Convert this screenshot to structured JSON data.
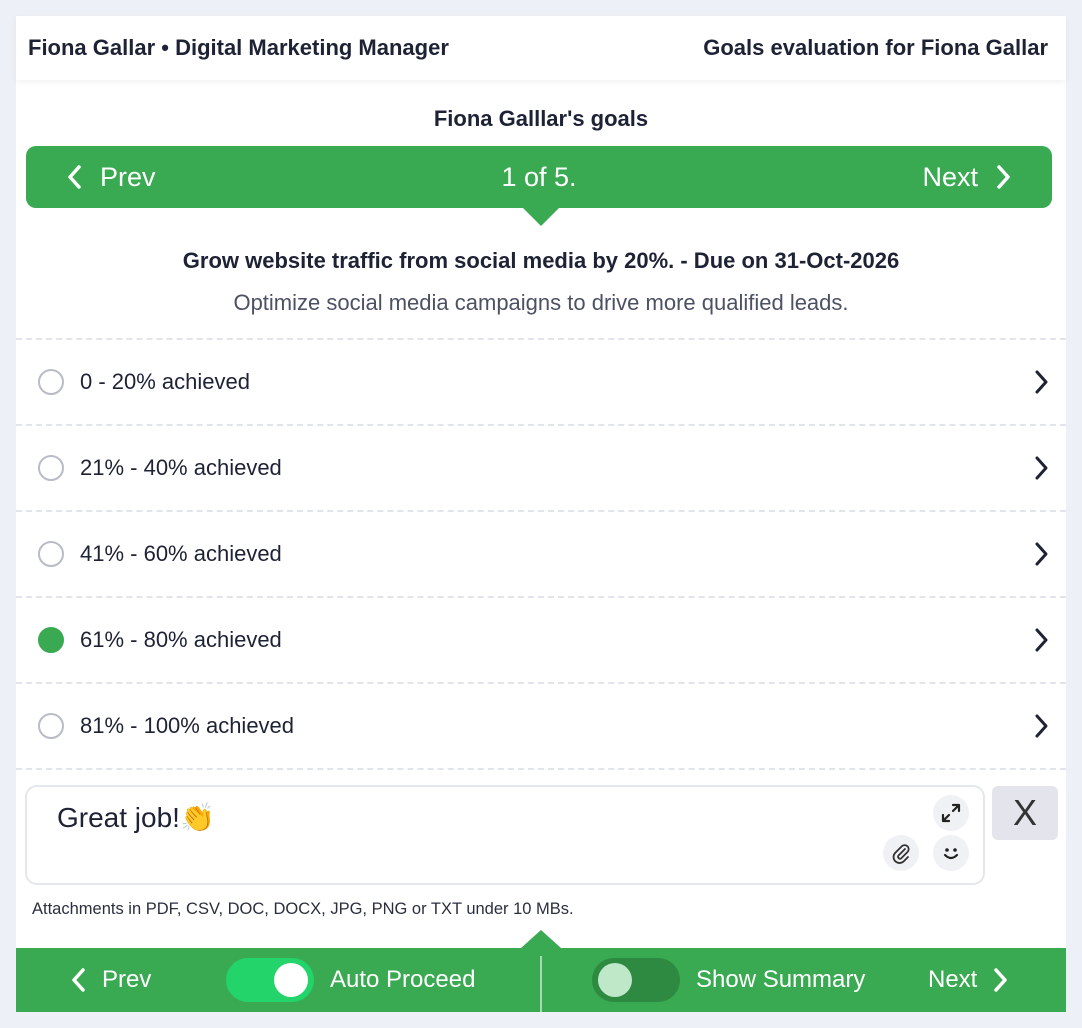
{
  "header": {
    "left": "Fiona Gallar • Digital Marketing Manager",
    "right": "Goals evaluation for Fiona Gallar"
  },
  "goals_title": "Fiona Galllar's goals",
  "goal_nav": {
    "prev": "Prev",
    "position": "1 of 5.",
    "next": "Next"
  },
  "goal": {
    "title": "Grow website traffic from social media by 20%. - Due on 31-Oct-2026",
    "description": "Optimize social media campaigns to drive more qualified leads."
  },
  "options": [
    {
      "label": "0 - 20% achieved",
      "selected": false
    },
    {
      "label": "21% - 40% achieved",
      "selected": false
    },
    {
      "label": "41% - 60% achieved",
      "selected": false
    },
    {
      "label": "61% - 80% achieved",
      "selected": true
    },
    {
      "label": "81% - 100% achieved",
      "selected": false
    }
  ],
  "comment": {
    "text": "Great job!👏",
    "clear_label": "X"
  },
  "attachments_hint": "Attachments in PDF, CSV, DOC, DOCX, JPG, PNG or TXT under 10 MBs.",
  "footer": {
    "prev": "Prev",
    "auto_proceed": {
      "label": "Auto Proceed",
      "on": true
    },
    "show_summary": {
      "label": "Show Summary",
      "on": false
    },
    "next": "Next"
  },
  "colors": {
    "accent": "#3aaa52",
    "toggle_on": "#22d46a"
  }
}
